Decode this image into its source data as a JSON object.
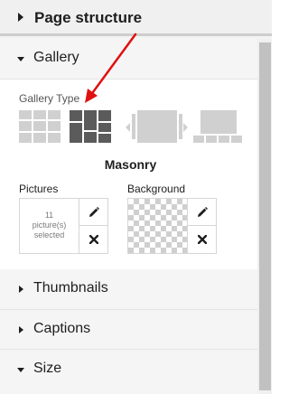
{
  "header": {
    "title": "Page structure"
  },
  "sections": {
    "gallery": {
      "label": "Gallery",
      "gallery_type_label": "Gallery Type",
      "types": [
        {
          "name": "grid",
          "selected": false
        },
        {
          "name": "masonry",
          "selected": true
        },
        {
          "name": "slider",
          "selected": false
        },
        {
          "name": "thumbnails",
          "selected": false
        }
      ],
      "selected_type": "Masonry",
      "pictures": {
        "label": "Pictures",
        "count": "11",
        "unit": "picture(s)",
        "state": "selected"
      },
      "background": {
        "label": "Background"
      }
    },
    "thumbnails": {
      "label": "Thumbnails"
    },
    "captions": {
      "label": "Captions"
    },
    "size": {
      "label": "Size"
    }
  },
  "colors": {
    "selected_icon": "#5b5b5b",
    "unselected_icon": "#d0d0d0",
    "annotation_arrow": "#e01010"
  }
}
